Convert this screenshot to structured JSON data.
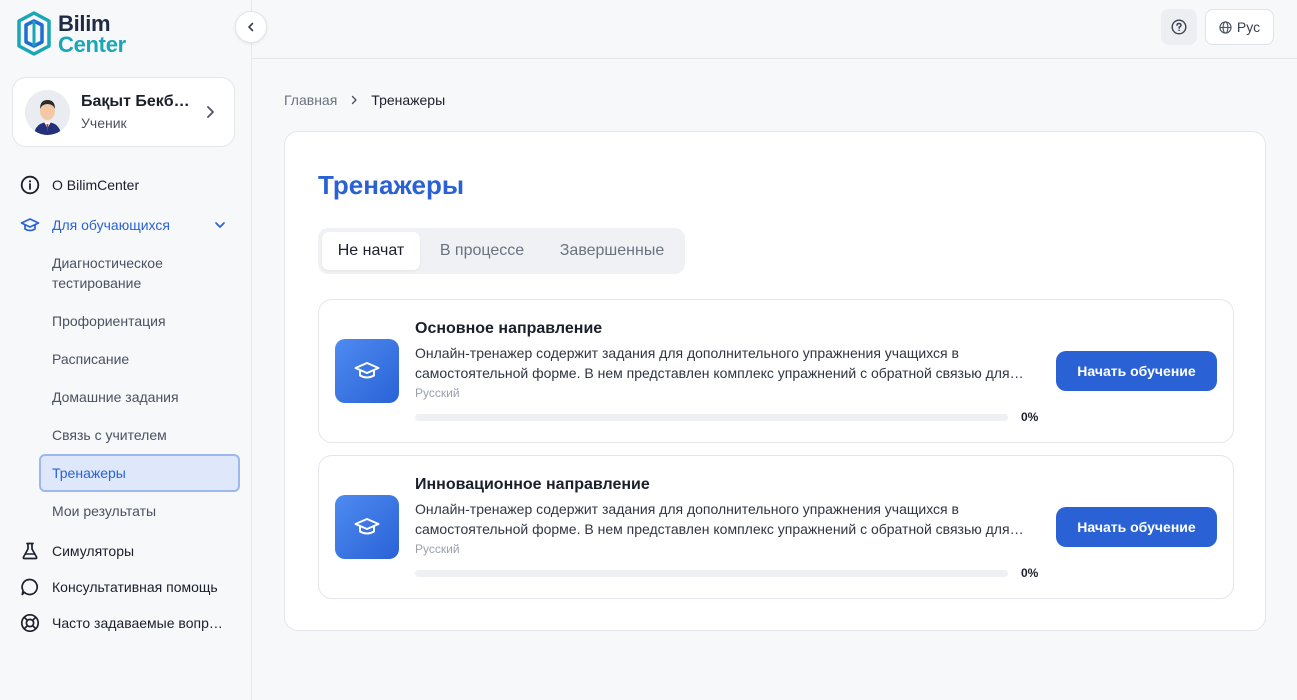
{
  "brand": {
    "line1": "Bilim",
    "line2": "Center",
    "accent": "#2a62d6",
    "teal": "#1aa6b7"
  },
  "profile": {
    "name": "Бақыт Бекбосынов",
    "role": "Ученик"
  },
  "sidebar": {
    "about": {
      "label": "О BilimCenter",
      "icon": "info-icon"
    },
    "students": {
      "label": "Для обучающихся",
      "icon": "graduation-cap-icon",
      "items": [
        "Диагностическое тестирование",
        "Профориентация",
        "Расписание",
        "Домашние задания",
        "Связь с учителем",
        "Тренажеры",
        "Мои результаты"
      ],
      "selected": "Тренажеры"
    },
    "simulators": {
      "label": "Симуляторы",
      "icon": "flask-icon"
    },
    "consult": {
      "label": "Консультативная помощь",
      "icon": "chat-bubble-icon"
    },
    "faq": {
      "label": "Часто задаваемые вопросы",
      "icon": "lifebuoy-icon"
    }
  },
  "header": {
    "lang": "Рус"
  },
  "breadcrumb": {
    "home": "Главная",
    "current": "Тренажеры"
  },
  "page": {
    "title": "Тренажеры",
    "tabs": [
      "Не начат",
      "В процессе",
      "Завершенные"
    ],
    "active_tab": "Не начат"
  },
  "courses": [
    {
      "title": "Основное направление",
      "description": "Онлайн-тренажер содержит задания для дополнительного упражнения учащихся в самостоятельной форме. В нем представлен комплекс упражнений с обратной связью для закрепления знаний.",
      "language": "Русский",
      "progress": 0,
      "progress_label": "0%",
      "button": "Начать обучение"
    },
    {
      "title": "Инновационное направление",
      "description": "Онлайн-тренажер содержит задания для дополнительного упражнения учащихся в самостоятельной форме. В нем представлен комплекс упражнений с обратной связью для закрепления знаний.",
      "language": "Русский",
      "progress": 0,
      "progress_label": "0%",
      "button": "Начать обучение"
    }
  ]
}
